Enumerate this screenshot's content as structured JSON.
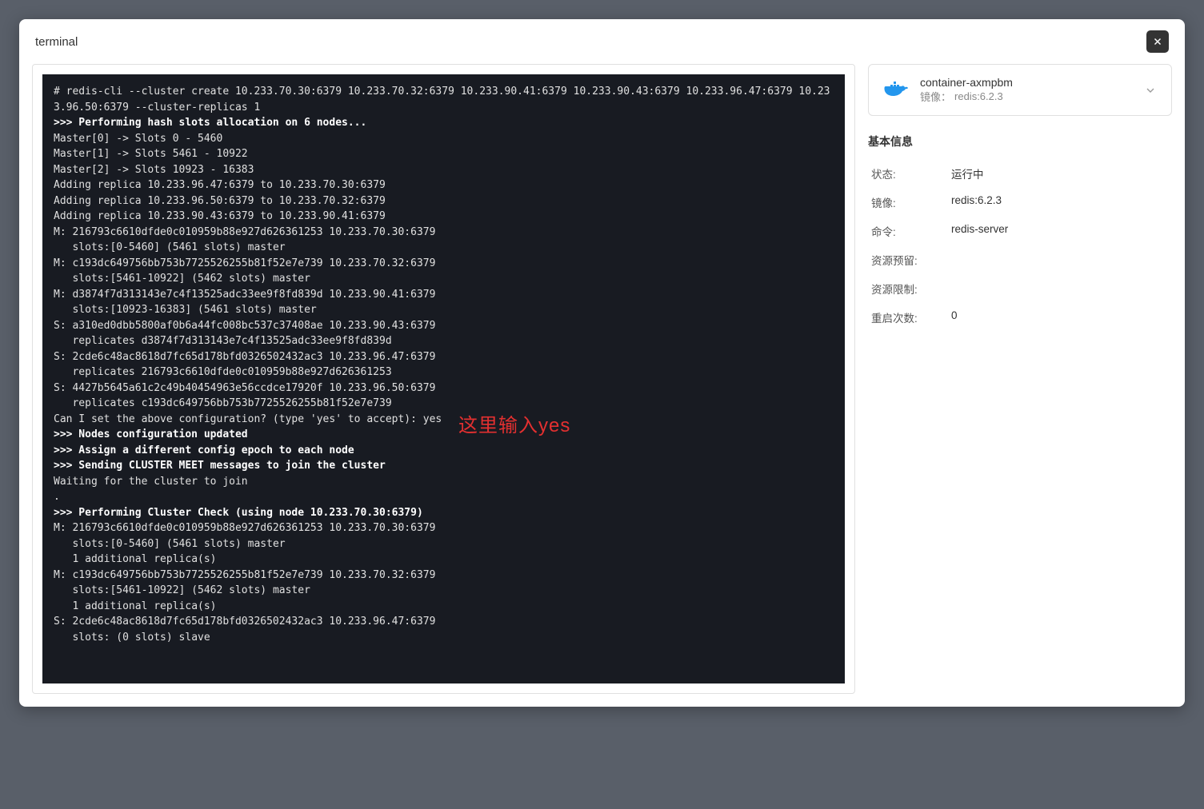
{
  "modal": {
    "title": "terminal"
  },
  "container": {
    "name": "container-axmpbm",
    "image_prefix": "镜像：",
    "image": "redis:6.2.3"
  },
  "basicInfo": {
    "section": "基本信息",
    "rows": [
      {
        "label": "状态:",
        "value": "运行中"
      },
      {
        "label": "镜像:",
        "value": "redis:6.2.3"
      },
      {
        "label": "命令:",
        "value": "redis-server"
      },
      {
        "label": "资源预留:",
        "value": ""
      },
      {
        "label": "资源限制:",
        "value": ""
      },
      {
        "label": "重启次数:",
        "value": "0"
      }
    ]
  },
  "annotation": "这里输入yes",
  "term": {
    "l0": "# redis-cli --cluster create 10.233.70.30:6379 10.233.70.32:6379 10.233.90.41:6379 10.233.90.43:6379 10.233.96.47:6379 10.233.96.50:6379 --cluster-replicas 1",
    "l1": ">>> Performing hash slots allocation on 6 nodes...",
    "l2": "Master[0] -> Slots 0 - 5460",
    "l3": "Master[1] -> Slots 5461 - 10922",
    "l4": "Master[2] -> Slots 10923 - 16383",
    "l5": "Adding replica 10.233.96.47:6379 to 10.233.70.30:6379",
    "l6": "Adding replica 10.233.96.50:6379 to 10.233.70.32:6379",
    "l7": "Adding replica 10.233.90.43:6379 to 10.233.90.41:6379",
    "l8": "M: 216793c6610dfde0c010959b88e927d626361253 10.233.70.30:6379",
    "l9": "   slots:[0-5460] (5461 slots) master",
    "l10": "M: c193dc649756bb753b7725526255b81f52e7e739 10.233.70.32:6379",
    "l11": "   slots:[5461-10922] (5462 slots) master",
    "l12": "M: d3874f7d313143e7c4f13525adc33ee9f8fd839d 10.233.90.41:6379",
    "l13": "   slots:[10923-16383] (5461 slots) master",
    "l14": "S: a310ed0dbb5800af0b6a44fc008bc537c37408ae 10.233.90.43:6379",
    "l15": "   replicates d3874f7d313143e7c4f13525adc33ee9f8fd839d",
    "l16": "S: 2cde6c48ac8618d7fc65d178bfd0326502432ac3 10.233.96.47:6379",
    "l17": "   replicates 216793c6610dfde0c010959b88e927d626361253",
    "l18": "S: 4427b5645a61c2c49b40454963e56ccdce17920f 10.233.96.50:6379",
    "l19": "   replicates c193dc649756bb753b7725526255b81f52e7e739",
    "l20": "Can I set the above configuration? (type 'yes' to accept): yes",
    "l21": ">>> Nodes configuration updated",
    "l22": ">>> Assign a different config epoch to each node",
    "l23": ">>> Sending CLUSTER MEET messages to join the cluster",
    "l24": "Waiting for the cluster to join",
    "l25": ".",
    "l26": ">>> Performing Cluster Check (using node 10.233.70.30:6379)",
    "l27": "M: 216793c6610dfde0c010959b88e927d626361253 10.233.70.30:6379",
    "l28": "   slots:[0-5460] (5461 slots) master",
    "l29": "   1 additional replica(s)",
    "l30": "M: c193dc649756bb753b7725526255b81f52e7e739 10.233.70.32:6379",
    "l31": "   slots:[5461-10922] (5462 slots) master",
    "l32": "   1 additional replica(s)",
    "l33": "S: 2cde6c48ac8618d7fc65d178bfd0326502432ac3 10.233.96.47:6379",
    "l34": "   slots: (0 slots) slave"
  }
}
